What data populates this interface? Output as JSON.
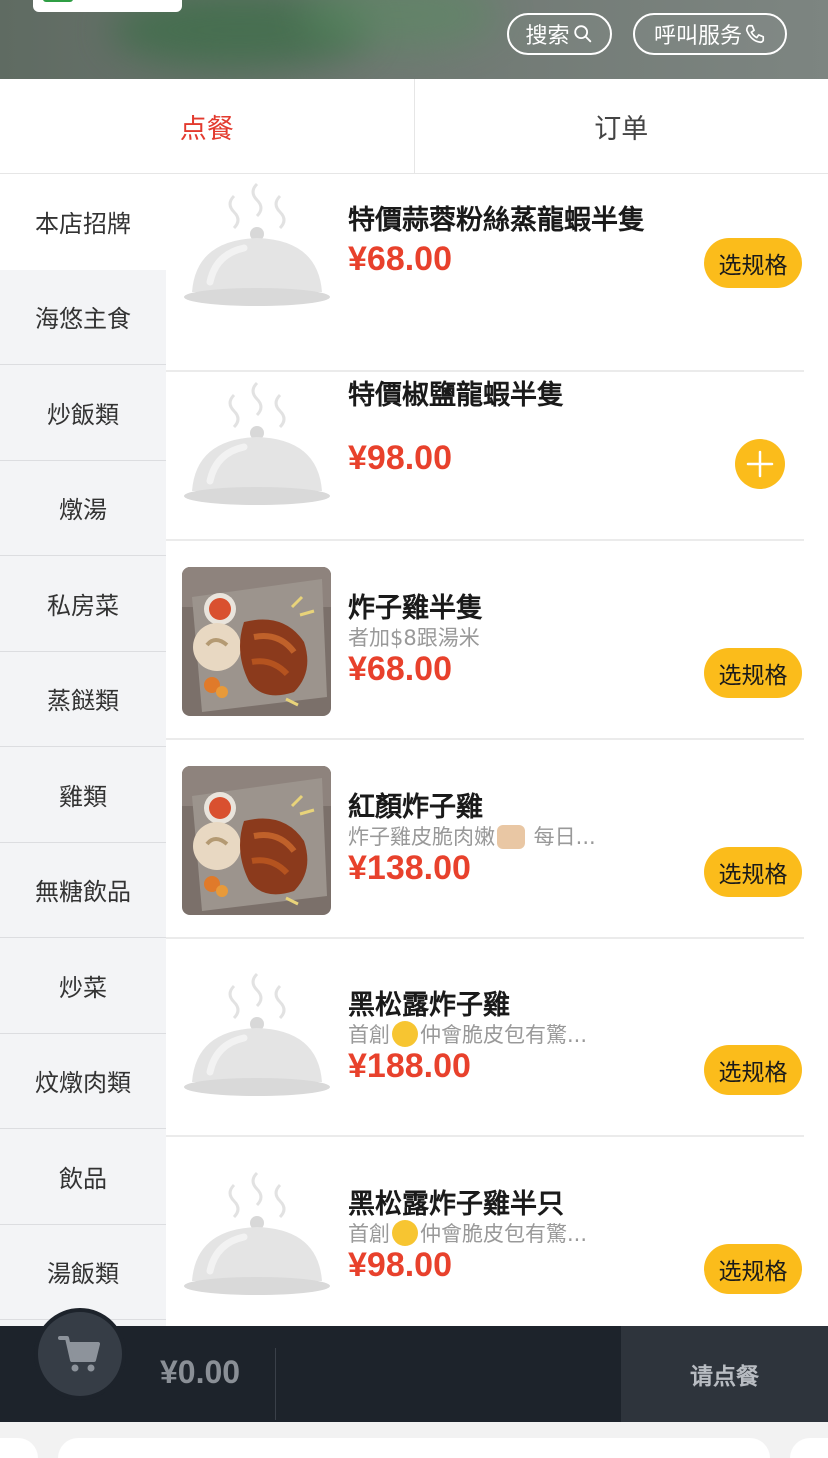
{
  "header": {
    "search_label": "搜索",
    "call_label": "呼叫服务"
  },
  "tabs": [
    {
      "label": "点餐",
      "active": true
    },
    {
      "label": "订单",
      "active": false
    }
  ],
  "sidebar": {
    "items": [
      {
        "label": "本店招牌"
      },
      {
        "label": "海悠主食"
      },
      {
        "label": "炒飯類"
      },
      {
        "label": "燉湯"
      },
      {
        "label": "私房菜"
      },
      {
        "label": "蒸餸類"
      },
      {
        "label": "雞類"
      },
      {
        "label": "無糖飲品"
      },
      {
        "label": "炒菜"
      },
      {
        "label": "炆燉肉類"
      },
      {
        "label": "飲品"
      },
      {
        "label": "湯飯類"
      }
    ]
  },
  "menu": {
    "items": [
      {
        "name": "特價蒜蓉粉絲蒸龍蝦半隻",
        "desc": "",
        "price": "¥68.00",
        "action": "选规格",
        "image": "placeholder-cloche-icon"
      },
      {
        "name": "特價椒鹽龍蝦半隻",
        "desc": "",
        "price": "¥98.00",
        "action": "+",
        "image": "placeholder-cloche-icon"
      },
      {
        "name": "炸子雞半隻",
        "desc": "者加$8跟湯米",
        "price": "¥68.00",
        "action": "选规格",
        "image": "fried-chicken-photo"
      },
      {
        "name": "紅顏炸子雞",
        "desc_before": "炸子雞皮脆肉嫩",
        "desc_emoji": "thumbs-up-emoji",
        "desc_after": " 每日...",
        "price": "¥138.00",
        "action": "选规格",
        "image": "fried-chicken-photo"
      },
      {
        "name": "黑松露炸子雞",
        "desc_before": "首創",
        "desc_emoji": "wink-emoji",
        "desc_after": "仲會脆皮包有驚...",
        "price": "¥188.00",
        "action": "选规格",
        "image": "placeholder-cloche-icon"
      },
      {
        "name": "黑松露炸子雞半只",
        "desc_before": "首創",
        "desc_emoji": "wink-emoji",
        "desc_after": "仲會脆皮包有驚...",
        "price": "¥98.00",
        "action": "选规格",
        "image": "placeholder-cloche-icon"
      }
    ]
  },
  "cart": {
    "total": "¥0.00",
    "order_label": "请点餐"
  },
  "colors": {
    "accent_red": "#e33a2e",
    "price_red": "#e8412c",
    "button_yellow": "#fbbc1b",
    "cartbar_bg": "#1d232b"
  }
}
